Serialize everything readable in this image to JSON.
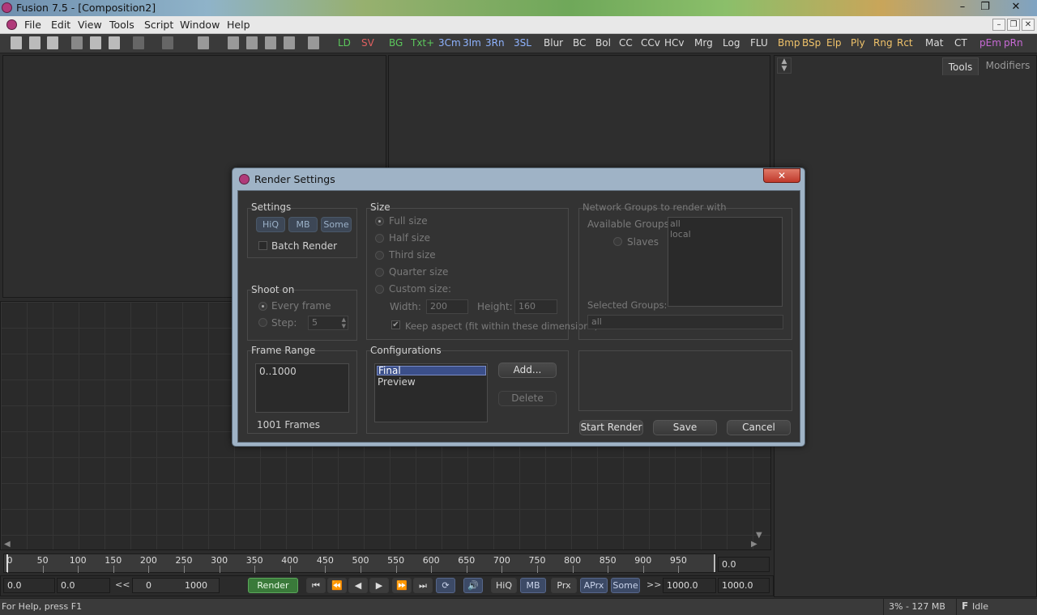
{
  "window": {
    "title": "Fusion 7.5 - [Composition2]"
  },
  "menu": [
    "File",
    "Edit",
    "View",
    "Tools",
    "Script",
    "Window",
    "Help"
  ],
  "toolbar_tools": [
    {
      "label": "LD",
      "color": "#5cc85c"
    },
    {
      "label": "SV",
      "color": "#e06060"
    },
    {
      "label": "BG",
      "color": "#5cc85c"
    },
    {
      "label": "Txt+",
      "color": "#5cc85c"
    },
    {
      "label": "3Cm",
      "color": "#8fb3ff"
    },
    {
      "label": "3Im",
      "color": "#8fb3ff"
    },
    {
      "label": "3Rn",
      "color": "#8fb3ff"
    },
    {
      "label": "3SL",
      "color": "#8fb3ff"
    },
    {
      "label": "Blur",
      "color": "#dcdcdc"
    },
    {
      "label": "BC",
      "color": "#dcdcdc"
    },
    {
      "label": "Bol",
      "color": "#dcdcdc"
    },
    {
      "label": "CC",
      "color": "#dcdcdc"
    },
    {
      "label": "CCv",
      "color": "#dcdcdc"
    },
    {
      "label": "HCv",
      "color": "#dcdcdc"
    },
    {
      "label": "Mrg",
      "color": "#dcdcdc"
    },
    {
      "label": "Log",
      "color": "#dcdcdc"
    },
    {
      "label": "FLU",
      "color": "#dcdcdc"
    },
    {
      "label": "Bmp",
      "color": "#f0c36a"
    },
    {
      "label": "BSp",
      "color": "#f0c36a"
    },
    {
      "label": "Elp",
      "color": "#f0c36a"
    },
    {
      "label": "Ply",
      "color": "#f0c36a"
    },
    {
      "label": "Rng",
      "color": "#f0c36a"
    },
    {
      "label": "Rct",
      "color": "#f0c36a"
    },
    {
      "label": "Mat",
      "color": "#dcdcdc"
    },
    {
      "label": "CT",
      "color": "#dcdcdc"
    },
    {
      "label": "pEm",
      "color": "#c86ad6"
    },
    {
      "label": "pRn",
      "color": "#c86ad6"
    }
  ],
  "side_tabs": {
    "tools": "Tools",
    "modifiers": "Modifiers"
  },
  "dialog": {
    "title": "Render Settings",
    "close": "✕",
    "settings": {
      "label": "Settings",
      "hiq": "HiQ",
      "mb": "MB",
      "some": "Some",
      "batch": "Batch Render"
    },
    "size": {
      "label": "Size",
      "full": "Full size",
      "half": "Half size",
      "third": "Third size",
      "quarter": "Quarter size",
      "custom": "Custom size:",
      "width_label": "Width:",
      "width": "200",
      "height_label": "Height:",
      "height": "160",
      "keep": "Keep aspect (fit within these dimensions)"
    },
    "network": {
      "label": "Network Groups to render with",
      "available": "Available Groups:",
      "slaves": "Slaves",
      "groups": [
        "all",
        "local"
      ],
      "selected_label": "Selected Groups:",
      "selected": "all"
    },
    "shoot": {
      "label": "Shoot on",
      "every": "Every frame",
      "step_label": "Step:",
      "step": "5"
    },
    "frame_range": {
      "label": "Frame Range",
      "value": "0..1000",
      "count": "1001 Frames"
    },
    "configs": {
      "label": "Configurations",
      "items": [
        "Final",
        "Preview"
      ],
      "add": "Add...",
      "delete": "Delete"
    },
    "buttons": {
      "start": "Start Render",
      "save": "Save",
      "cancel": "Cancel"
    }
  },
  "timeline": {
    "ticks": [
      "0",
      "50",
      "100",
      "150",
      "200",
      "250",
      "300",
      "350",
      "400",
      "450",
      "500",
      "550",
      "600",
      "650",
      "700",
      "750",
      "800",
      "850",
      "900",
      "950"
    ],
    "current": "0.0",
    "start": "0.0",
    "start2": "0.0",
    "lt": "<<",
    "range_start": "0",
    "range_end": "1000",
    "render": "Render",
    "hiq": "HiQ",
    "mb": "MB",
    "prx": "Prx",
    "aprx": "APrx",
    "some": "Some",
    "gt": ">>",
    "end": "1000.0",
    "end2": "1000.0"
  },
  "status": {
    "help": "For Help, press F1",
    "mem": "3% - 127 MB",
    "f": "F",
    "state": "Idle"
  }
}
